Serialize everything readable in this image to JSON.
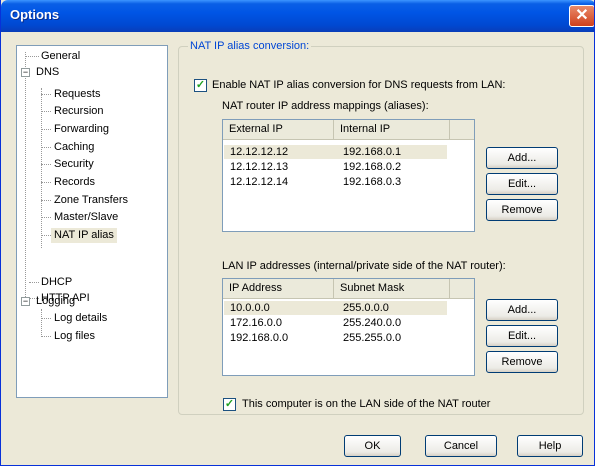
{
  "window": {
    "title": "Options",
    "close_glyph": "✕"
  },
  "tree": {
    "general": "General",
    "dns": "DNS",
    "dns_children": [
      "Requests",
      "Recursion",
      "Forwarding",
      "Caching",
      "Security",
      "Records",
      "Zone Transfers",
      "Master/Slave",
      "NAT IP alias"
    ],
    "dhcp": "DHCP",
    "http_api": "HTTP API",
    "logging": "Logging",
    "logging_children": [
      "Log details",
      "Log files"
    ],
    "selected": "NAT IP alias"
  },
  "group": {
    "title": "NAT IP alias conversion:",
    "enable_label": "Enable NAT IP alias conversion for DNS requests from LAN:",
    "enable_checked": true,
    "mappings_label": "NAT router IP address mappings (aliases):",
    "mappings_columns": [
      "External IP",
      "Internal IP"
    ],
    "mappings_rows": [
      [
        "12.12.12.12",
        "192.168.0.1"
      ],
      [
        "12.12.12.13",
        "192.168.0.2"
      ],
      [
        "12.12.12.14",
        "192.168.0.3"
      ]
    ],
    "lan_label": "LAN IP addresses (internal/private side of the NAT router):",
    "lan_columns": [
      "IP Address",
      "Subnet Mask"
    ],
    "lan_rows": [
      [
        "10.0.0.0",
        "255.0.0.0"
      ],
      [
        "172.16.0.0",
        "255.240.0.0"
      ],
      [
        "192.168.0.0",
        "255.255.0.0"
      ]
    ],
    "lan_side_label": "This computer is on the LAN side of the NAT router",
    "lan_side_checked": true
  },
  "buttons": {
    "add": "Add...",
    "edit": "Edit...",
    "remove": "Remove",
    "ok": "OK",
    "cancel": "Cancel",
    "help": "Help"
  },
  "colors": {
    "titlebar": "#0055e5",
    "group_title": "#0046d5",
    "check": "#21a121",
    "close": "#d0401c"
  },
  "icons": {
    "check": "✓",
    "expand_minus": "−"
  }
}
